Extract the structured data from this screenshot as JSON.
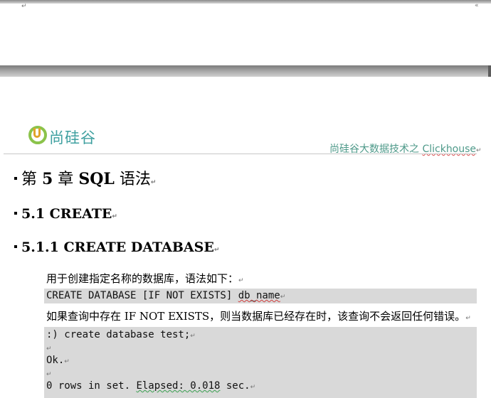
{
  "marks": {
    "paragraph": "↵",
    "corner": "↵",
    "top_right": "«"
  },
  "header": {
    "logo_text": "尚硅谷",
    "title_prefix": "尚硅谷大数据技术之 ",
    "title_brand": "Clickhouse"
  },
  "headings": {
    "chapter_pre": "第 ",
    "chapter_num": "5",
    "chapter_mid": " 章  ",
    "chapter_title": "SQL",
    "chapter_suf": " 语法",
    "section": "5.1 CREATE",
    "subsection": "5.1.1 CREATE DATABASE"
  },
  "body": {
    "intro": "用于创建指定名称的数据库，语法如下：",
    "syntax_main": "CREATE DATABASE [IF NOT EXISTS] ",
    "syntax_arg": "db_name",
    "desc": "如果查询中存在 IF NOT EXISTS，则当数据库已经存在时，该查询不会返回任何错误。",
    "example_lines": [
      ":) create database test;",
      "",
      "Ok.",
      "",
      "0 rows in set. "
    ],
    "example_elapsed": "Elapsed: 0.018",
    "example_tail": " sec."
  }
}
